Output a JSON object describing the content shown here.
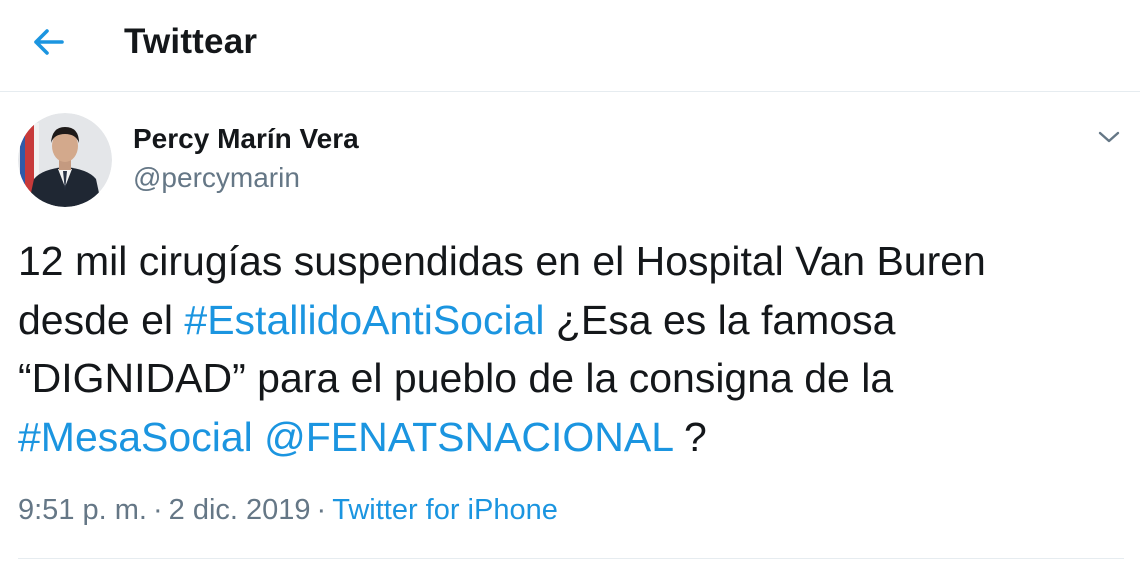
{
  "header": {
    "title": "Twittear",
    "back_icon": "arrow-left-icon"
  },
  "colors": {
    "accent": "#1b95e0",
    "text": "#14171a",
    "secondary": "#657786",
    "border": "#e6ecf0"
  },
  "tweet": {
    "author": {
      "display_name": "Percy Marín Vera",
      "handle": "@percymarin"
    },
    "menu_icon": "chevron-down-icon",
    "text_lines": [
      [
        {
          "text": "12 mil cirugías suspendidas en el Hospital Van Buren",
          "link": false
        }
      ],
      [
        {
          "text": "desde el ",
          "link": false
        },
        {
          "text": "#EstallidoAntiSocial",
          "link": true
        },
        {
          "text": " ¿Esa es la famosa",
          "link": false
        }
      ],
      [
        {
          "text": "“DIGNIDAD” para el pueblo de la consigna de la",
          "link": false
        }
      ],
      [
        {
          "text": "#MesaSocial",
          "link": true
        },
        {
          "text": " ",
          "link": false
        },
        {
          "text": "@FENATSNACIONAL",
          "link": true
        },
        {
          "text": " ?",
          "link": false
        }
      ]
    ],
    "time": "9:51 p. m.",
    "separator": "·",
    "date": "2 dic. 2019",
    "source": "Twitter for iPhone"
  }
}
